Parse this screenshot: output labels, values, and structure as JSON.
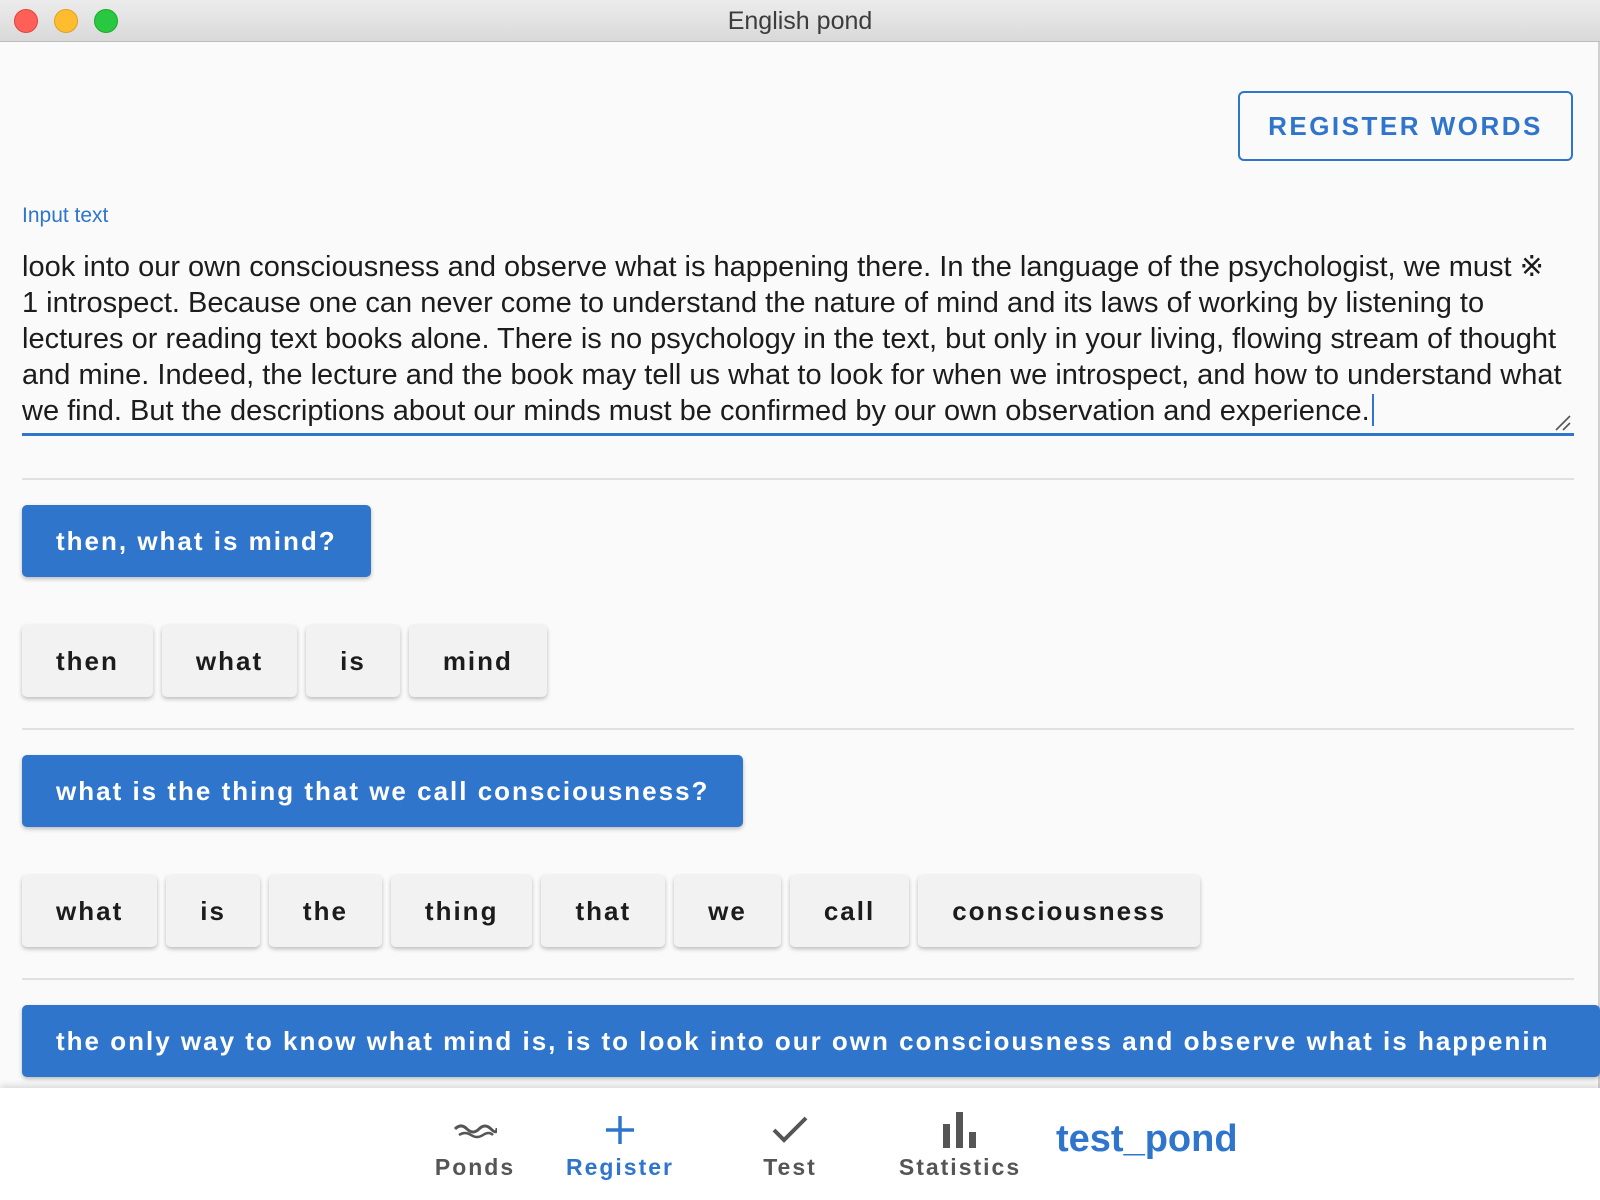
{
  "window": {
    "title": "English pond"
  },
  "toolbar": {
    "register_words_label": "REGISTER WORDS"
  },
  "input": {
    "label": "Input text",
    "value": "look into our own consciousness and observe what is happening there. In the language of the psychologist, we must ※ 1 introspect. Because one can never come to understand the nature of mind and its laws of working by listening to lectures or reading text books alone. There is no psychology in the text, but only in your living, flowing stream of thought and mine. Indeed, the lecture and the book may tell us what to look for when we introspect, and how to understand what we find. But the descriptions about our minds must be confirmed by our own observation and experience."
  },
  "sentences": [
    {
      "text": "then, what is mind?",
      "words": [
        "then",
        "what",
        "is",
        "mind"
      ]
    },
    {
      "text": "what is the thing that we call consciousness?",
      "words": [
        "what",
        "is",
        "the",
        "thing",
        "that",
        "we",
        "call",
        "consciousness"
      ]
    },
    {
      "text": "the only way to know what mind is, is to look into our own consciousness and observe what is happenin",
      "words": []
    }
  ],
  "nav": {
    "items": [
      {
        "label": "Ponds",
        "icon": "wave-icon"
      },
      {
        "label": "Register",
        "icon": "plus-icon"
      },
      {
        "label": "Test",
        "icon": "check-icon"
      },
      {
        "label": "Statistics",
        "icon": "bar-chart-icon"
      }
    ],
    "active": "Register",
    "pond_name": "test_pond"
  },
  "colors": {
    "accent": "#2f75cc",
    "word_button": "#f2f2f2",
    "background": "#fafafa"
  }
}
